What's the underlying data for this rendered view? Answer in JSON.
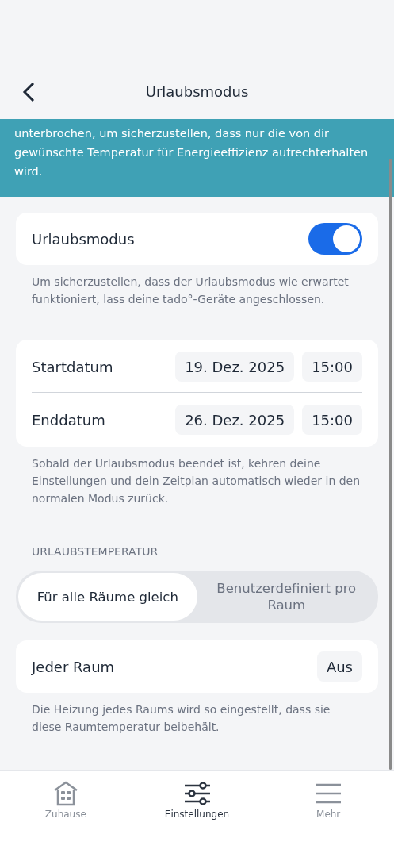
{
  "header": {
    "title": "Urlaubsmodus"
  },
  "banner": {
    "text": "unterbrochen, um sicherzustellen, dass nur die von dir gewünschte Temperatur für Energieeffizienz aufrechterhalten wird."
  },
  "vacation_mode": {
    "label": "Urlaubsmodus",
    "on": true,
    "note": "Um sicherzustellen, dass der Urlaubsmodus wie erwartet funktioniert, lass deine tado°-Geräte angeschlossen."
  },
  "dates": [
    {
      "label": "Startdatum",
      "date": "19. Dez. 2025",
      "time": "15:00"
    },
    {
      "label": "Enddatum",
      "date": "26. Dez. 2025",
      "time": "15:00"
    }
  ],
  "dates_note": "Sobald der Urlaubsmodus beendet ist, kehren deine Einstellungen und dein Zeitplan automatisch wieder in den normalen Modus zurück.",
  "temperature": {
    "heading": "URLAUBSTEMPERATUR",
    "options": [
      {
        "label": "Für alle Räume gleich",
        "selected": true
      },
      {
        "label": "Benutzerdefiniert pro Raum",
        "selected": false
      }
    ],
    "room": {
      "label": "Jeder Raum",
      "value": "Aus"
    },
    "note": "Die Heizung jedes Raums wird so eingestellt, dass sie diese Raumtemperatur beibehält."
  },
  "nav": [
    {
      "kind": "home",
      "label": "Zuhause",
      "selected": false
    },
    {
      "kind": "settings",
      "label": "Einstellungen",
      "selected": true
    },
    {
      "kind": "more",
      "label": "Mehr",
      "selected": false
    }
  ]
}
